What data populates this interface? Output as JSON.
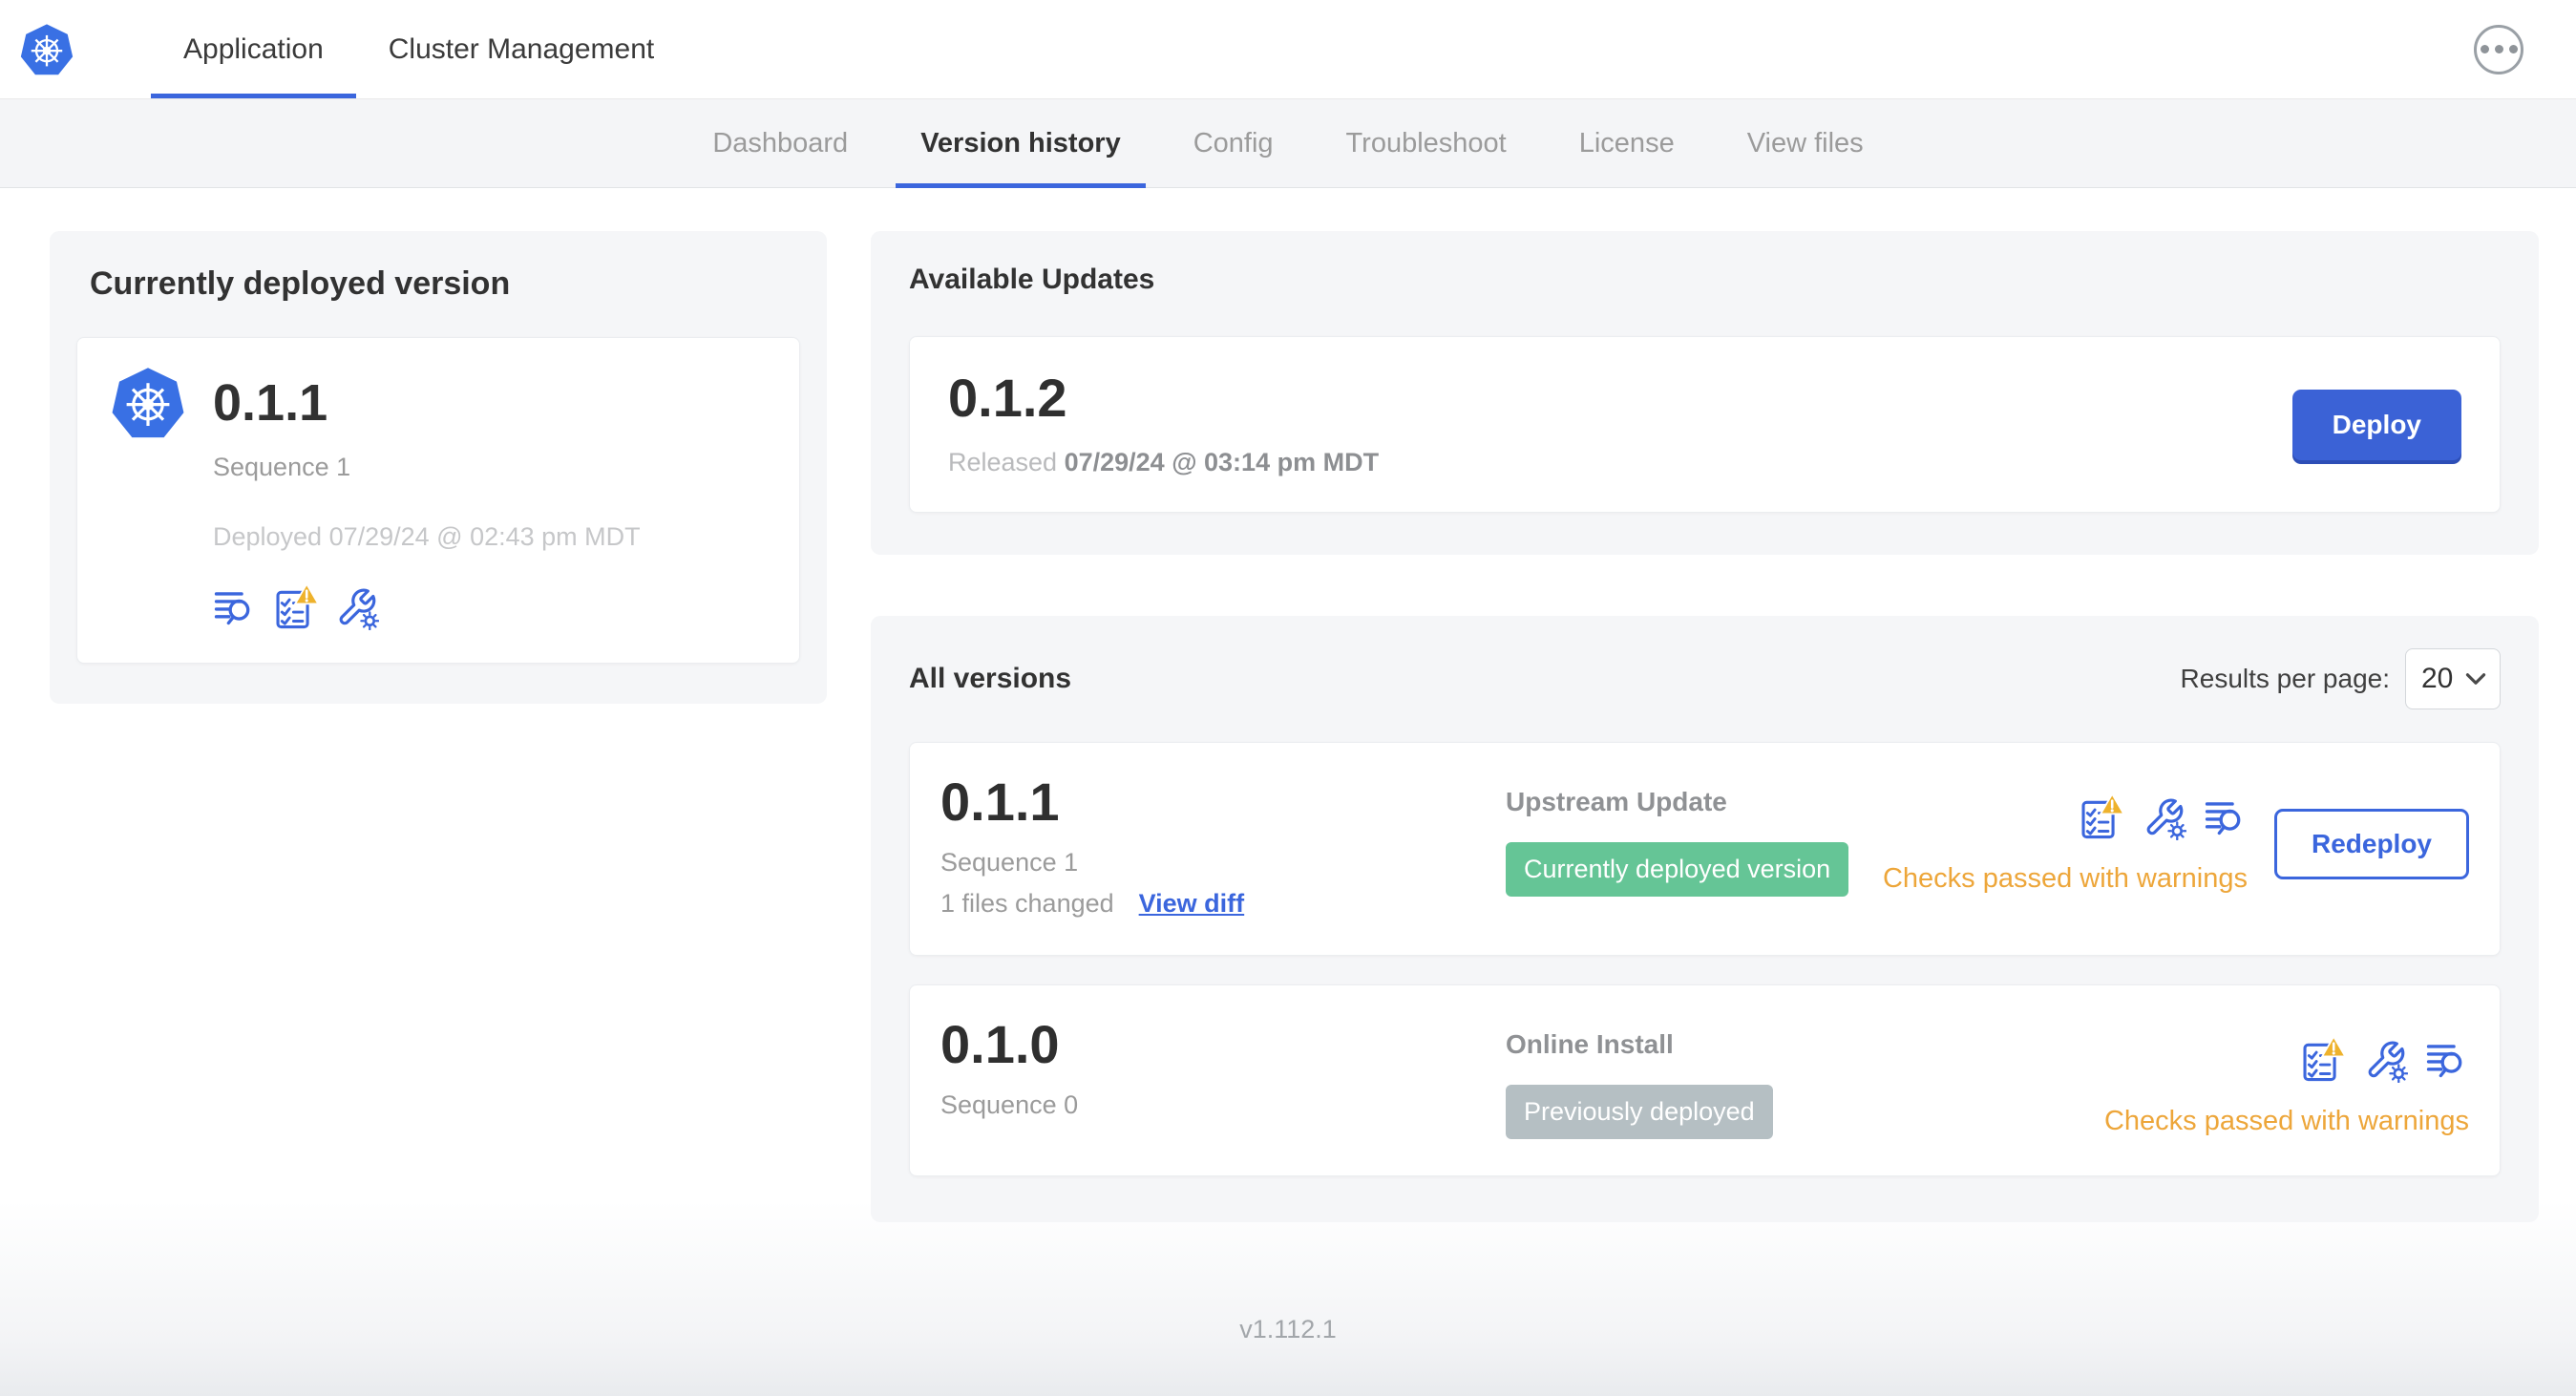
{
  "header": {
    "logo_icon": "kubernetes-logo",
    "tabs": [
      {
        "label": "Application",
        "active": true
      },
      {
        "label": "Cluster Management",
        "active": false
      }
    ],
    "menu_icon": "ellipsis-menu-icon"
  },
  "subnav": {
    "tabs": [
      {
        "label": "Dashboard",
        "active": false
      },
      {
        "label": "Version history",
        "active": true
      },
      {
        "label": "Config",
        "active": false
      },
      {
        "label": "Troubleshoot",
        "active": false
      },
      {
        "label": "License",
        "active": false
      },
      {
        "label": "View files",
        "active": false
      }
    ]
  },
  "current_version_card": {
    "title": "Currently deployed version",
    "version": "0.1.1",
    "sequence": "Sequence 1",
    "deployed": "Deployed 07/29/24 @ 02:43 pm MDT",
    "icons": [
      "release-notes-icon",
      "preflight-checks-warning-icon",
      "config-icon"
    ]
  },
  "available_updates": {
    "title": "Available Updates",
    "version": "0.1.2",
    "released_prefix": "Released",
    "released_date": "07/29/24 @ 03:14 pm MDT",
    "deploy_label": "Deploy"
  },
  "all_versions": {
    "title": "All versions",
    "results_per_page_label": "Results per page:",
    "results_per_page_value": "20",
    "rows": [
      {
        "version": "0.1.1",
        "sequence": "Sequence 1",
        "files_changed": "1 files changed",
        "view_diff_label": "View diff",
        "source": "Upstream Update",
        "badge": "Currently deployed version",
        "badge_color": "#65c596",
        "status": "Checks passed with warnings",
        "action_label": "Redeploy",
        "icons": [
          "preflight-checks-warning-icon",
          "config-icon",
          "release-notes-icon"
        ]
      },
      {
        "version": "0.1.0",
        "sequence": "Sequence 0",
        "source": "Online Install",
        "badge": "Previously deployed",
        "badge_color": "#b5bfc3",
        "status": "Checks passed with warnings",
        "icons": [
          "preflight-checks-warning-icon",
          "config-icon",
          "release-notes-icon"
        ]
      }
    ]
  },
  "footer": {
    "app_version": "v1.112.1"
  },
  "colors": {
    "accent_blue": "#3b66dd",
    "kubernetes_blue": "#3970e4",
    "deploy_button_blue": "#3b62d6",
    "badge_green": "#65c596",
    "badge_gray": "#b5bfc3",
    "warning_orange": "#eda63a",
    "card_background": "#f5f6f8"
  }
}
